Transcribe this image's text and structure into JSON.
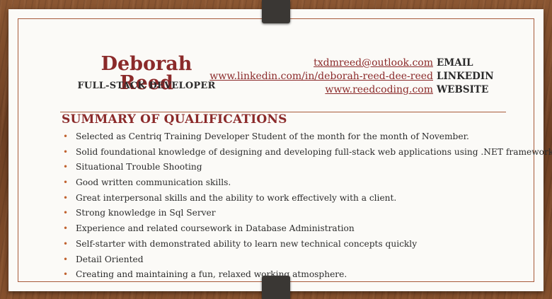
{
  "resume": {
    "name": "Deborah Reed",
    "title": "FULL-STACK DEVELOPER",
    "contacts": [
      {
        "value": "txdmreed@outlook.com",
        "label": "EMAIL"
      },
      {
        "value": "www.linkedin.com/in/deborah-reed-dee-reed",
        "label": "LINKEDIN"
      },
      {
        "value": "www.reedcoding.com",
        "label": "WEBSITE"
      }
    ],
    "section_title": "SUMMARY OF QUALIFICATIONS",
    "bullet_icon": "bullet-dot",
    "qualifications": [
      "Selected as Centriq Training Developer Student of the month for the month of November.",
      "Solid foundational knowledge of designing and developing full-stack web applications using .NET framework.",
      "Situational Trouble Shooting",
      "Good written communication skills.",
      "Great interpersonal skills and the ability to work effectively with a client.",
      "Strong knowledge in Sql Server",
      "Experience and related coursework in Database Administration",
      "Self-starter with demonstrated ability to learn new technical concepts quickly",
      "Detail Oriented",
      "Creating and maintaining a fun, relaxed working atmosphere."
    ]
  },
  "colors": {
    "accent": "#8b2a2a",
    "frame": "#a75a3a",
    "bullet": "#c0622f",
    "paper": "#fbfaf7",
    "wood": "#7a4a2a"
  }
}
